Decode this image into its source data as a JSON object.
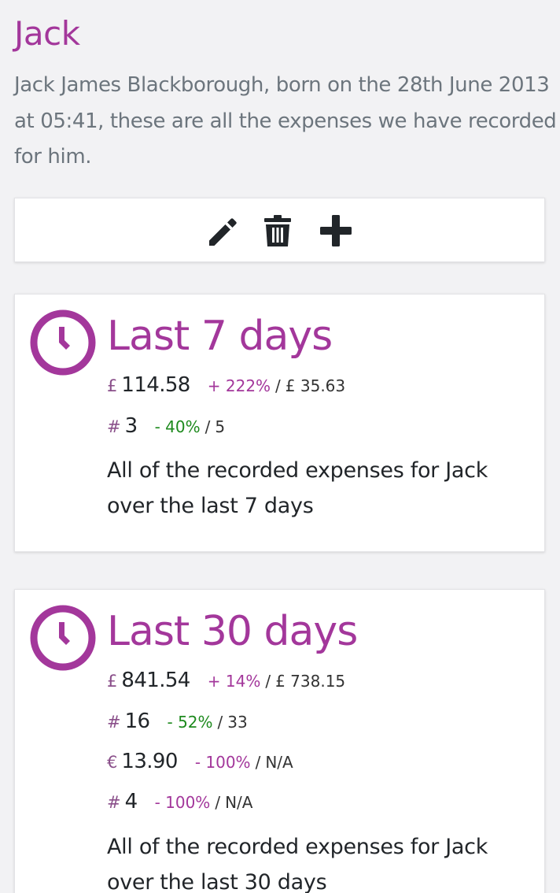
{
  "header": {
    "title": "Jack",
    "intro": "Jack James Blackborough, born on the 28th June 2013 at 05:41, these are all the expenses we have recorded for him."
  },
  "toolbar": {
    "icons": [
      "pencil-icon",
      "trash-icon",
      "plus-icon"
    ]
  },
  "colors": {
    "accent": "#a3379b",
    "positive": "#1e8a1e",
    "text": "#212529",
    "muted": "#6c757d"
  },
  "cards": [
    {
      "title": "Last 7 days",
      "icon": "clock-icon",
      "stats": [
        {
          "symbol": "£",
          "value": "114.58",
          "change": "+ 222%",
          "sep": "/",
          "previous": "£ 35.63"
        },
        {
          "symbol": "#",
          "value": "3",
          "change": "- 40%",
          "sep": "/",
          "previous": "5"
        }
      ],
      "description": "All of the recorded expenses for Jack over the last 7 days"
    },
    {
      "title": "Last 30 days",
      "icon": "clock-icon",
      "stats": [
        {
          "symbol": "£",
          "value": "841.54",
          "change": "+ 14%",
          "sep": "/",
          "previous": "£ 738.15"
        },
        {
          "symbol": "#",
          "value": "16",
          "change": "- 52%",
          "sep": "/",
          "previous": "33"
        },
        {
          "symbol": "€",
          "value": "13.90",
          "change": "- 100%",
          "sep": "/",
          "previous": "N/A"
        },
        {
          "symbol": "#",
          "value": "4",
          "change": "- 100%",
          "sep": "/",
          "previous": "N/A"
        }
      ],
      "description": "All of the recorded expenses for Jack over the last 30 days"
    }
  ]
}
